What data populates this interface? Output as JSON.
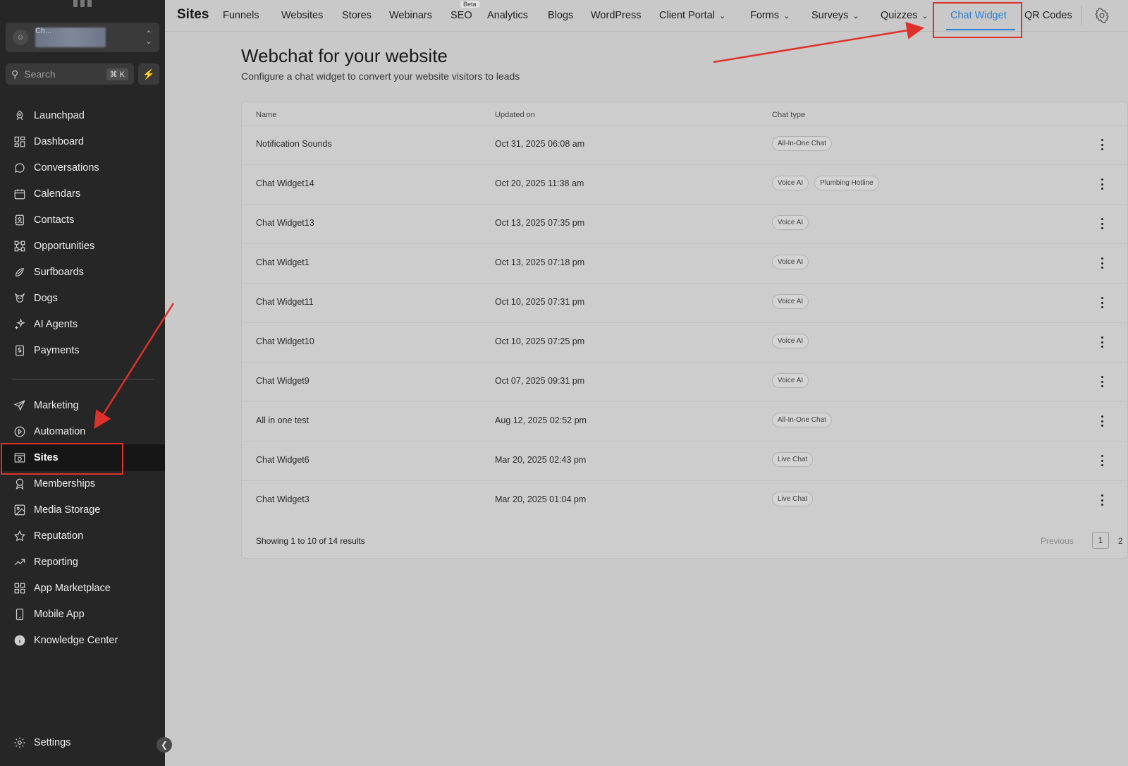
{
  "sidebar": {
    "account_name": "Ch...",
    "search_placeholder": "Search",
    "search_shortcut": "⌘ K",
    "items_top": [
      {
        "label": "Launchpad",
        "icon": "rocket-icon"
      },
      {
        "label": "Dashboard",
        "icon": "dashboard-grid-icon"
      },
      {
        "label": "Conversations",
        "icon": "chat-bubble-icon"
      },
      {
        "label": "Calendars",
        "icon": "calendar-icon"
      },
      {
        "label": "Contacts",
        "icon": "contact-book-icon"
      },
      {
        "label": "Opportunities",
        "icon": "opportunities-icon"
      },
      {
        "label": "Surfboards",
        "icon": "surfboard-icon"
      },
      {
        "label": "Dogs",
        "icon": "dog-icon"
      },
      {
        "label": "AI Agents",
        "icon": "sparkle-icon"
      },
      {
        "label": "Payments",
        "icon": "payments-icon"
      }
    ],
    "items_bottom": [
      {
        "label": "Marketing",
        "icon": "send-icon"
      },
      {
        "label": "Automation",
        "icon": "automation-icon"
      },
      {
        "label": "Sites",
        "icon": "sites-icon"
      },
      {
        "label": "Memberships",
        "icon": "badge-icon"
      },
      {
        "label": "Media Storage",
        "icon": "image-icon"
      },
      {
        "label": "Reputation",
        "icon": "star-icon"
      },
      {
        "label": "Reporting",
        "icon": "trend-icon"
      },
      {
        "label": "App Marketplace",
        "icon": "apps-grid-icon"
      },
      {
        "label": "Mobile App",
        "icon": "phone-icon"
      },
      {
        "label": "Knowledge Center",
        "icon": "info-icon"
      }
    ],
    "settings_label": "Settings"
  },
  "topbar": {
    "title": "Sites",
    "tabs": [
      "Funnels",
      "Websites",
      "Stores",
      "Webinars",
      "SEO",
      "Analytics",
      "Blogs",
      "WordPress",
      "Client Portal",
      "Forms",
      "Surveys",
      "Quizzes",
      "Chat Widget",
      "QR Codes"
    ],
    "beta_label": "Beta",
    "active_tab": "Chat Widget"
  },
  "main": {
    "title": "Webchat for your website",
    "subtitle": "Configure a chat widget to convert your website visitors to leads",
    "columns": [
      "Name",
      "Updated on",
      "Chat type"
    ],
    "rows": [
      {
        "name": "Notification Sounds",
        "updated": "Oct 31, 2025 06:08 am",
        "tags": [
          "All-In-One Chat"
        ]
      },
      {
        "name": "Chat Widget14",
        "updated": "Oct 20, 2025 11:38 am",
        "tags": [
          "Voice AI",
          "Plumbing Hotline"
        ]
      },
      {
        "name": "Chat Widget13",
        "updated": "Oct 13, 2025 07:35 pm",
        "tags": [
          "Voice AI"
        ]
      },
      {
        "name": "Chat Widget1",
        "updated": "Oct 13, 2025 07:18 pm",
        "tags": [
          "Voice AI"
        ]
      },
      {
        "name": "Chat Widget11",
        "updated": "Oct 10, 2025 07:31 pm",
        "tags": [
          "Voice AI"
        ]
      },
      {
        "name": "Chat Widget10",
        "updated": "Oct 10, 2025 07:25 pm",
        "tags": [
          "Voice AI"
        ]
      },
      {
        "name": "Chat Widget9",
        "updated": "Oct 07, 2025 09:31 pm",
        "tags": [
          "Voice AI"
        ]
      },
      {
        "name": "All in one test",
        "updated": "Aug 12, 2025 02:52 pm",
        "tags": [
          "All-In-One Chat"
        ]
      },
      {
        "name": "Chat Widget6",
        "updated": "Mar 20, 2025 02:43 pm",
        "tags": [
          "Live Chat"
        ]
      },
      {
        "name": "Chat Widget3",
        "updated": "Mar 20, 2025 01:04 pm",
        "tags": [
          "Live Chat"
        ]
      }
    ],
    "footer": "Showing 1 to 10 of 14 results",
    "pagination": {
      "previous": "Previous",
      "pages": [
        "1",
        "2"
      ],
      "current": "1"
    }
  },
  "colors": {
    "accent": "#2a7fd4",
    "highlight": "#e0302a",
    "sidebar_bg": "#262626"
  }
}
